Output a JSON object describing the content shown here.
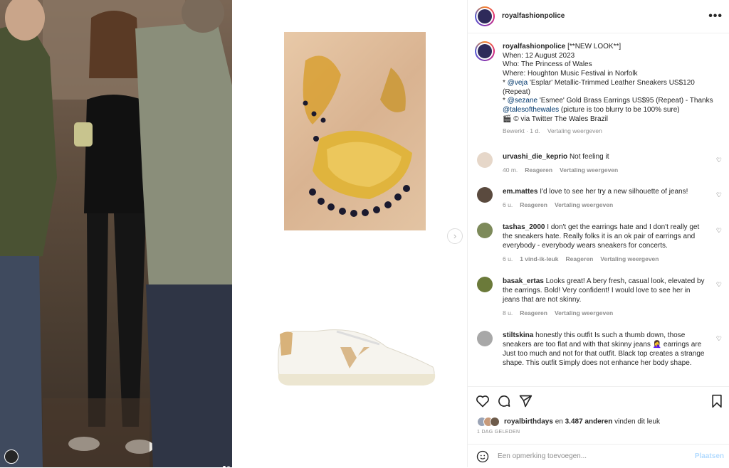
{
  "post": {
    "username": "royalfashionpolice",
    "more_label": "•••",
    "caption": {
      "username": "royalfashionpolice",
      "headline": "[**NEW LOOK**]",
      "lines": [
        "When: 12 August 2023",
        "Who: The Princess of Wales",
        "Where: Houghton Music Festival in Norfolk"
      ],
      "item1_prefix": "* ",
      "item1_mention": "@veja",
      "item1_text": " 'Esplar' Metallic-Trimmed Leather Sneakers US$120",
      "item1_cont": "(Repeat)",
      "item2_prefix": "* ",
      "item2_mention": "@sezane",
      "item2_text": " 'Esmee' Gold Brass Earrings US$95 (Repeat) - Thanks",
      "item3_mention": "@talesofthewales",
      "item3_text": " (picture is too blurry to be 100% sure)",
      "credit": "🎬 © via Twitter The Wales Brazil",
      "edited": "Bewerkt · 1 d.",
      "translate": "Vertaling weergeven"
    }
  },
  "comments": [
    {
      "user": "urvashi_die_keprio",
      "text": "Not feeling it",
      "time": "40 m.",
      "reply": "Reageren",
      "translate": "Vertaling weergeven",
      "likes": ""
    },
    {
      "user": "em.mattes",
      "text": "I'd love to see her try a new silhouette of jeans!",
      "time": "6 u.",
      "reply": "Reageren",
      "translate": "Vertaling weergeven",
      "likes": ""
    },
    {
      "user": "tashas_2000",
      "text": "I don't get the earrings hate and I don't really get the sneakers hate. Really folks it is an ok pair of earrings and everybody - everybody wears sneakers for concerts.",
      "time": "6 u.",
      "reply": "Reageren",
      "translate": "Vertaling weergeven",
      "likes": "1 vind-ik-leuk"
    },
    {
      "user": "basak_ertas",
      "text": "Looks great! A bery fresh, casual look, elevated by the earrings. Bold! Very confident! I would love to see her in jeans that are not skinny.",
      "time": "8 u.",
      "reply": "Reageren",
      "translate": "Vertaling weergeven",
      "likes": ""
    },
    {
      "user": "stiltskina",
      "text": "honestly this outfit Is such a thumb down, those sneakers are too flat and with that skinny jeans 🤦‍♀️ earrings are Just too much and not for that outfit. Black top creates a strange shape. This outfit Simply does not enhance her body shape.",
      "time": "",
      "reply": "",
      "translate": "",
      "likes": ""
    }
  ],
  "likes": {
    "user": "royalbirthdays",
    "mid": " en ",
    "count": "3.487 anderen",
    "suffix": " vinden dit leuk"
  },
  "date": "1 DAG GELEDEN",
  "add_comment": {
    "placeholder": "Een opmerking toevoegen...",
    "post_label": "Plaatsen"
  },
  "icons": {
    "heart": "heart-icon",
    "comment": "comment-icon",
    "share": "share-icon",
    "save": "bookmark-icon",
    "emoji": "emoji-icon",
    "next": "chevron-right-icon"
  }
}
